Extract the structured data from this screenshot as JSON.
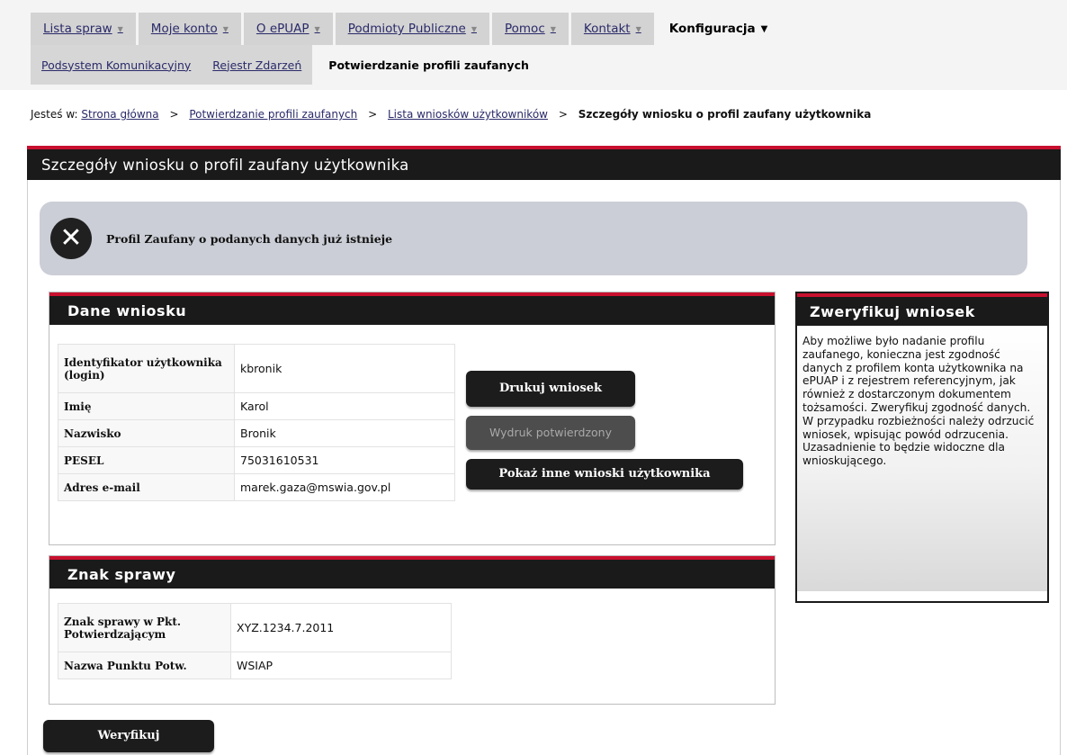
{
  "nav": {
    "tabs": [
      {
        "label": "Lista spraw"
      },
      {
        "label": "Moje konto"
      },
      {
        "label": "O ePUAP"
      },
      {
        "label": "Podmioty Publiczne"
      },
      {
        "label": "Pomoc"
      },
      {
        "label": "Kontakt"
      },
      {
        "label": "Konfiguracja"
      }
    ],
    "subtabs": [
      {
        "label": "Podsystem Komunikacyjny"
      },
      {
        "label": "Rejestr Zdarzeń"
      },
      {
        "label": "Potwierdzanie profili zaufanych"
      }
    ]
  },
  "breadcrumb": {
    "prefix": "Jesteś w:",
    "items": [
      "Strona główna",
      "Potwierdzanie profili zaufanych",
      "Lista wniosków użytkowników"
    ],
    "current": "Szczegóły wniosku o profil zaufany użytkownika",
    "separator": ">"
  },
  "main": {
    "title": "Szczegóły wniosku o profil zaufany użytkownika"
  },
  "error": {
    "message": "Profil Zaufany o podanych danych już istnieje"
  },
  "application": {
    "title": "Dane wniosku",
    "rows": [
      {
        "label": "Identyfikator użytkownika (login)",
        "value": "kbronik"
      },
      {
        "label": "Imię",
        "value": "Karol"
      },
      {
        "label": "Nazwisko",
        "value": "Bronik"
      },
      {
        "label": "PESEL",
        "value": "75031610531"
      },
      {
        "label": "Adres e-mail",
        "value": "marek.gaza@mswia.gov.pl"
      }
    ],
    "buttons": {
      "print": "Drukuj wniosek",
      "confirmed": "Wydruk potwierdzony",
      "show_other": "Pokaż inne wnioski użytkownika"
    }
  },
  "case": {
    "title": "Znak sprawy",
    "rows": [
      {
        "label": "Znak sprawy w Pkt. Potwierdzającym",
        "value": "XYZ.1234.7.2011"
      },
      {
        "label": "Nazwa Punktu Potw.",
        "value": "WSIAP"
      }
    ]
  },
  "verify": {
    "title": "Zweryfikuj wniosek",
    "text": "Aby możliwe było nadanie profilu zaufanego, konieczna jest zgodność danych z profilem konta użytkownika na ePUAP i z rejestrem referencyjnym, jak również z dostarczonym dokumentem tożsamości. Zweryfikuj zgodność danych. W przypadku rozbieżności należy odrzucić wniosek, wpisując powód odrzucenia. Uzasadnienie to będzie widoczne dla wnioskującego.",
    "button": "Weryfikuj"
  },
  "colors": {
    "header_bg": "#1a1a1a",
    "accent": "#c8102e",
    "error_bg": "#cbced6"
  }
}
